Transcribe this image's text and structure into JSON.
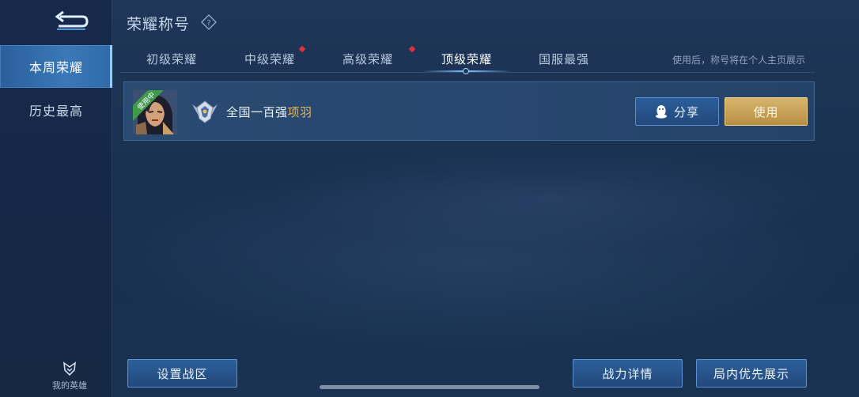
{
  "header": {
    "title": "荣耀称号",
    "hint": "使用后，称号将在个人主页展示"
  },
  "sidebar": {
    "items": [
      {
        "label": "本周荣耀",
        "active": true
      },
      {
        "label": "历史最高",
        "active": false
      }
    ],
    "my_hero_label": "我的英雄"
  },
  "tabs": [
    {
      "label": "初级荣耀",
      "active": false,
      "red_dot": false
    },
    {
      "label": "中级荣耀",
      "active": false,
      "red_dot": true
    },
    {
      "label": "高级荣耀",
      "active": false,
      "red_dot": true
    },
    {
      "label": "顶级荣耀",
      "active": true,
      "red_dot": false
    },
    {
      "label": "国服最强",
      "active": false,
      "red_dot": false
    }
  ],
  "title_row": {
    "in_use_tag": "使用中",
    "title_prefix": "全国一百强",
    "hero_name": "项羽",
    "share_label": "分享",
    "use_label": "使用"
  },
  "bottom": {
    "set_region_label": "设置战区",
    "power_detail_label": "战力详情",
    "in_game_display_label": "局内优先展示"
  },
  "colors": {
    "background": "#1b2f4e",
    "active_sidebar": "#3a78b8",
    "hero_name": "#e4b45a",
    "use_button": "#c9a25a",
    "in_use_ribbon": "#3f9a4c",
    "red_dot": "#e0323c"
  },
  "icons": {
    "back": "back-arrow-icon",
    "help": "question-diamond-icon",
    "rank": "rank-badge-icon",
    "share": "qq-penguin-icon",
    "my_hero": "hero-mask-icon"
  }
}
